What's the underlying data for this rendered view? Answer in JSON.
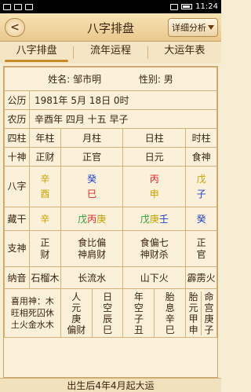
{
  "statusbar": {
    "time": "11:24"
  },
  "header": {
    "title": "八字排盘",
    "back_label": "<",
    "detail_label": "详细分析"
  },
  "tabs": [
    {
      "label": "八字排盘"
    },
    {
      "label": "流年运程"
    },
    {
      "label": "大运年表"
    }
  ],
  "info": {
    "name_label": "姓名:",
    "name": "邹市明",
    "gender_label": "性别:",
    "gender": "男",
    "gongli_label": "公历",
    "gongli": "1981年 5月 18日 0时",
    "nongli_label": "农历",
    "nongli": "辛酉年 四月 十五 早子"
  },
  "pillars": {
    "label": "四柱",
    "heads": [
      "年柱",
      "月柱",
      "日柱",
      "时柱"
    ]
  },
  "shishen": {
    "label": "十神",
    "values": [
      "正财",
      "正官",
      "日元",
      "食神"
    ]
  },
  "bazi": {
    "label": "八字",
    "stems": [
      "辛",
      "癸",
      "丙",
      "戊"
    ],
    "branches": [
      "酉",
      "巳",
      "申",
      "子"
    ]
  },
  "canggan": {
    "label": "藏干",
    "year": [
      "辛"
    ],
    "month": [
      "戊",
      "丙",
      "庚"
    ],
    "day": [
      "戊",
      "庚",
      "壬"
    ],
    "hour": [
      "癸"
    ]
  },
  "zhishen": {
    "label": "支神",
    "year": [
      "正",
      "财"
    ],
    "month": [
      "食比偏",
      "神肩财"
    ],
    "day": [
      "食偏七",
      "神财杀"
    ],
    "hour": [
      "正",
      "官"
    ]
  },
  "nayin": {
    "label": "纳音",
    "values": [
      "石榴木",
      "长流水",
      "山下火",
      "霹雳火"
    ]
  },
  "extra": {
    "xiyong": "喜用神：木",
    "wang": "旺相死囚休",
    "wuxing": "土火金水木",
    "cols": [
      {
        "t1": "人",
        "t2": "元",
        "t3": "庚",
        "t4": "偏财"
      },
      {
        "t1": "日",
        "t2": "空",
        "t3": "辰",
        "t4": "巳"
      },
      {
        "t1": "年",
        "t2": "空",
        "t3": "子",
        "t4": "丑"
      },
      {
        "t1": "胎",
        "t2": "息",
        "t3": "辛",
        "t4": "巳"
      },
      {
        "t1": "胎",
        "t2": "元",
        "t3": "甲",
        "t4": "申"
      },
      {
        "t1": "命",
        "t2": "宫",
        "t3": "庚",
        "t4": "子"
      }
    ]
  },
  "footer": {
    "text": "出生后4年4月起大运"
  }
}
